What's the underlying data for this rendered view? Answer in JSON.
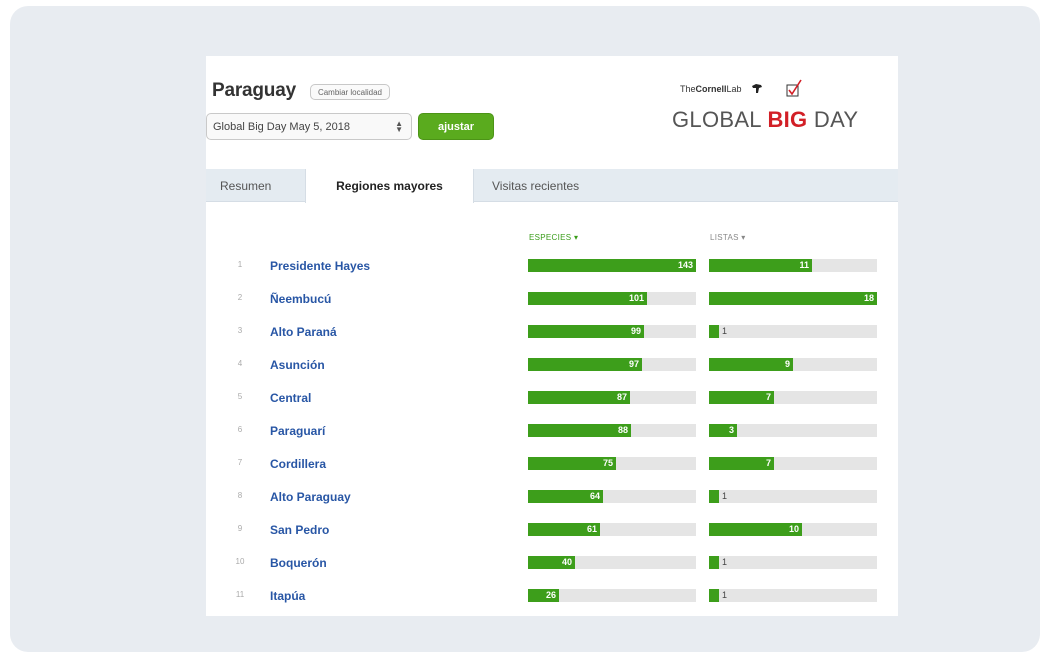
{
  "header": {
    "title": "Paraguay",
    "change_location_label": "Cambiar localidad",
    "event_select_value": "Global Big Day May 5, 2018",
    "adjust_label": "ajustar"
  },
  "logo": {
    "prefix": "The",
    "cornell": "Cornell",
    "lab": "Lab",
    "global": "GLOBAL ",
    "big": "BIG",
    "day": " DAY"
  },
  "tabs": [
    {
      "label": "Resumen",
      "active": false
    },
    {
      "label": "Regiones mayores",
      "active": true
    },
    {
      "label": "Visitas recientes",
      "active": false
    }
  ],
  "table": {
    "species_header": "ESPECIES ▾",
    "lists_header": "LISTAS ▾",
    "species_max": 143,
    "lists_max": 18,
    "rows": [
      {
        "rank": "1",
        "name": "Presidente Hayes",
        "species": 143,
        "lists": 11
      },
      {
        "rank": "2",
        "name": "Ñeembucú",
        "species": 101,
        "lists": 18
      },
      {
        "rank": "3",
        "name": "Alto Paraná",
        "species": 99,
        "lists": 1
      },
      {
        "rank": "4",
        "name": "Asunción",
        "species": 97,
        "lists": 9
      },
      {
        "rank": "5",
        "name": "Central",
        "species": 87,
        "lists": 7
      },
      {
        "rank": "6",
        "name": "Paraguarí",
        "species": 88,
        "lists": 3
      },
      {
        "rank": "7",
        "name": "Cordillera",
        "species": 75,
        "lists": 7
      },
      {
        "rank": "8",
        "name": "Alto Paraguay",
        "species": 64,
        "lists": 1
      },
      {
        "rank": "9",
        "name": "San Pedro",
        "species": 61,
        "lists": 10
      },
      {
        "rank": "10",
        "name": "Boquerón",
        "species": 40,
        "lists": 1
      },
      {
        "rank": "11",
        "name": "Itapúa",
        "species": 26,
        "lists": 1
      }
    ]
  },
  "colors": {
    "bar_fill": "#3d9e1b",
    "bar_track": "#e5e5e5",
    "region_link": "#2856a5",
    "adjust_button": "#5aab1e",
    "logo_big": "#d21f26"
  }
}
